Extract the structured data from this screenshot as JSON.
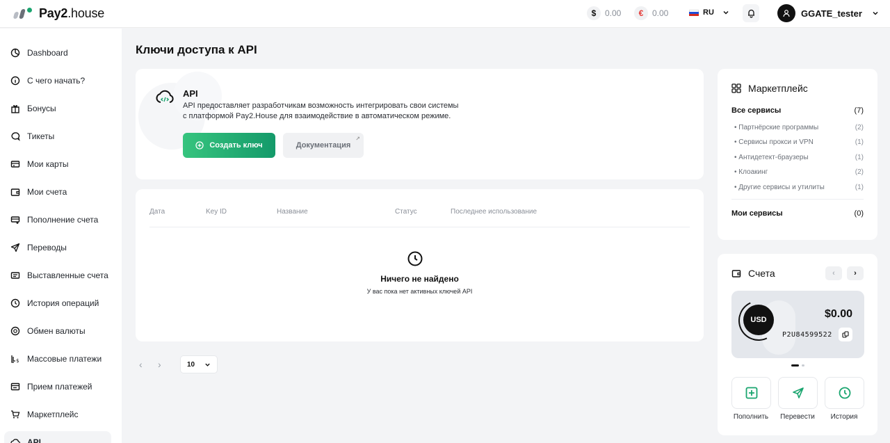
{
  "header": {
    "logo_main": "Pay2",
    "logo_suffix": ".house",
    "balance_usd_symbol": "$",
    "balance_usd": "0.00",
    "balance_eur_symbol": "€",
    "balance_eur": "0.00",
    "language": "RU",
    "username": "GGATE_tester"
  },
  "sidebar": {
    "items": [
      {
        "label": "Dashboard",
        "icon": "dashboard-icon"
      },
      {
        "label": "С чего начать?",
        "icon": "info-icon"
      },
      {
        "label": "Бонусы",
        "icon": "gift-icon"
      },
      {
        "label": "Тикеты",
        "icon": "chat-icon"
      },
      {
        "label": "Мои карты",
        "icon": "card-icon"
      },
      {
        "label": "Мои счета",
        "icon": "wallet-icon"
      },
      {
        "label": "Пополнение счета",
        "icon": "topup-icon"
      },
      {
        "label": "Переводы",
        "icon": "send-icon"
      },
      {
        "label": "Выставленные счета",
        "icon": "invoice-icon"
      },
      {
        "label": "История операций",
        "icon": "history-icon"
      },
      {
        "label": "Обмен валюты",
        "icon": "exchange-icon"
      },
      {
        "label": "Массовые платежи",
        "icon": "mass-payment-icon"
      },
      {
        "label": "Прием платежей",
        "icon": "payment-accept-icon"
      },
      {
        "label": "Маркетплейс",
        "icon": "cart-icon"
      },
      {
        "label": "API",
        "icon": "api-icon"
      }
    ]
  },
  "main": {
    "title": "Ключи доступа к API",
    "api": {
      "title": "API",
      "description": "API предоставляет разработчикам возможность интегрировать свои системы с платформой Pay2.House для взаимодействие в автоматическом режиме.",
      "create_label": "Создать ключ",
      "docs_label": "Документация"
    },
    "table": {
      "columns": [
        "Дата",
        "Key ID",
        "Название",
        "Статус",
        "Последнее использование"
      ],
      "empty_title": "Ничего не найдено",
      "empty_subtitle": "У вас пока нет активных ключей API"
    },
    "pagination": {
      "per_page": "10"
    }
  },
  "marketplace": {
    "title": "Маркетплейс",
    "all_label": "Все сервисы",
    "all_count": "(7)",
    "categories": [
      {
        "label": "Партнёрские программы",
        "count": "(2)"
      },
      {
        "label": "Сервисы прокси и VPN",
        "count": "(1)"
      },
      {
        "label": "Антидетект-браузеры",
        "count": "(1)"
      },
      {
        "label": "Клоакинг",
        "count": "(2)"
      },
      {
        "label": "Другие сервисы и утилиты",
        "count": "(1)"
      }
    ],
    "my_label": "Мои сервисы",
    "my_count": "(0)"
  },
  "accounts": {
    "title": "Счета",
    "currency": "USD",
    "amount": "$0.00",
    "number": "P2U84599522",
    "actions": [
      {
        "label": "Пополнить",
        "icon": "plus-icon"
      },
      {
        "label": "Перевести",
        "icon": "send-icon"
      },
      {
        "label": "История",
        "icon": "history-icon"
      }
    ]
  },
  "colors": {
    "accent_green": "#149a6a",
    "background": "#f3f4f6"
  }
}
